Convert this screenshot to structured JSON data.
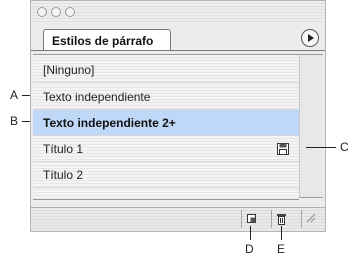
{
  "panel": {
    "tab_label": "Estilos de párrafo",
    "styles": [
      {
        "label": "[Ninguno]",
        "selected": false
      },
      {
        "label": "Texto independiente",
        "selected": false
      },
      {
        "label": "Texto independiente 2+",
        "selected": true
      },
      {
        "label": "Título 1",
        "selected": false
      },
      {
        "label": "Título 2",
        "selected": false
      }
    ],
    "colors": {
      "selection": "#bfd8f7",
      "panel_bg": "#ececec",
      "outline": "#7a7a7a"
    },
    "icons": {
      "menu": "panel-menu-icon",
      "save": "disk-icon",
      "new": "new-style-icon",
      "delete": "trash-icon",
      "resize": "resize-grip-icon"
    }
  },
  "callouts": {
    "a": "A",
    "b": "B",
    "c": "C",
    "d": "D",
    "e": "E"
  }
}
